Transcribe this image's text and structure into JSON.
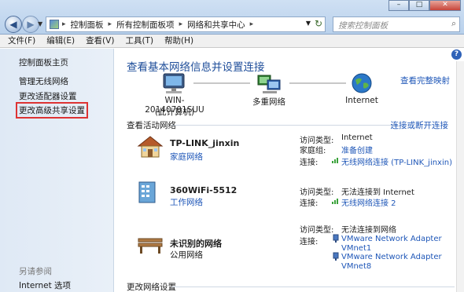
{
  "window": {
    "minimize": "–",
    "maximize": "□",
    "close": "✕"
  },
  "nav": {
    "back": "◀",
    "forward": "▶",
    "dropdown": "▼"
  },
  "address": {
    "crumbs": [
      "控制面板",
      "所有控制面板项",
      "网络和共享中心"
    ],
    "refresh": "↻",
    "dropdown": "▼"
  },
  "search": {
    "placeholder": "搜索控制面板",
    "icon": "search-icon",
    "glyph": "⌕"
  },
  "menu": [
    "文件(F)",
    "编辑(E)",
    "查看(V)",
    "工具(T)",
    "帮助(H)"
  ],
  "left": {
    "home": "控制面板主页",
    "items": [
      "管理无线网络",
      "更改适配器设置",
      "更改高级共享设置"
    ],
    "see_also": "另请参阅",
    "internet_options": "Internet 选项"
  },
  "main": {
    "help": "?",
    "title": "查看基本网络信息并设置连接",
    "view_full_map": "查看完整映射",
    "map": {
      "computer_name": "WIN-20140701SUU",
      "computer_sub": "(此计算机)",
      "multi_network": "多重网络",
      "internet": "Internet"
    },
    "active_title": "查看活动网络",
    "connect_disconnect": "连接或断开连接",
    "labels": {
      "access_type": "访问类型:",
      "homegroup": "家庭组:",
      "connection": "连接:"
    },
    "networks": [
      {
        "name": "TP-LINK_jinxin",
        "type": "家庭网络",
        "access": "Internet",
        "homegroup": "准备创建",
        "connection": "无线网络连接 (TP-LINK_jinxin)"
      },
      {
        "name": "360WiFi-5512",
        "type": "工作网络",
        "access": "无法连接到 Internet",
        "connection": "无线网络连接 2"
      },
      {
        "name": "未识别的网络",
        "type": "公用网络",
        "access": "无法连接到网络",
        "connection_1": "VMware Network Adapter",
        "connection_1b": "VMnet1",
        "connection_2": "VMware Network Adapter",
        "connection_2b": "VMnet8"
      }
    ],
    "change_settings": "更改网络设置"
  }
}
